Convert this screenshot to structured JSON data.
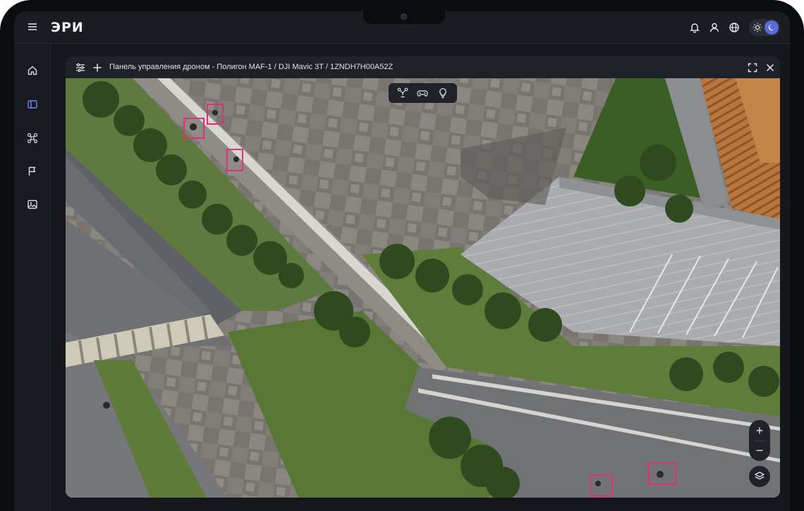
{
  "app": {
    "logo": "ЭРИ"
  },
  "topbar": {
    "icons": [
      "bell-icon",
      "user-icon",
      "globe-icon",
      "sun-icon",
      "moon-icon"
    ]
  },
  "sidebar": {
    "items": [
      {
        "icon": "home-icon"
      },
      {
        "icon": "panel-icon",
        "active": true
      },
      {
        "icon": "drone-icon"
      },
      {
        "icon": "flag-icon"
      },
      {
        "icon": "image-icon"
      }
    ]
  },
  "panel": {
    "title": "Панель управления дроном - Полигон MAF-1 / DJI Mavic 3T / 1ZNDH7H00A52Z"
  },
  "map": {
    "toolbar": [
      "drone-icon",
      "gamepad-icon",
      "lightbulb-icon"
    ],
    "zoom_in": "+",
    "zoom_out": "−",
    "detections": 5
  },
  "colors": {
    "accent": "#5b6cd9",
    "detection": "#e0307a",
    "background": "#15171d"
  }
}
